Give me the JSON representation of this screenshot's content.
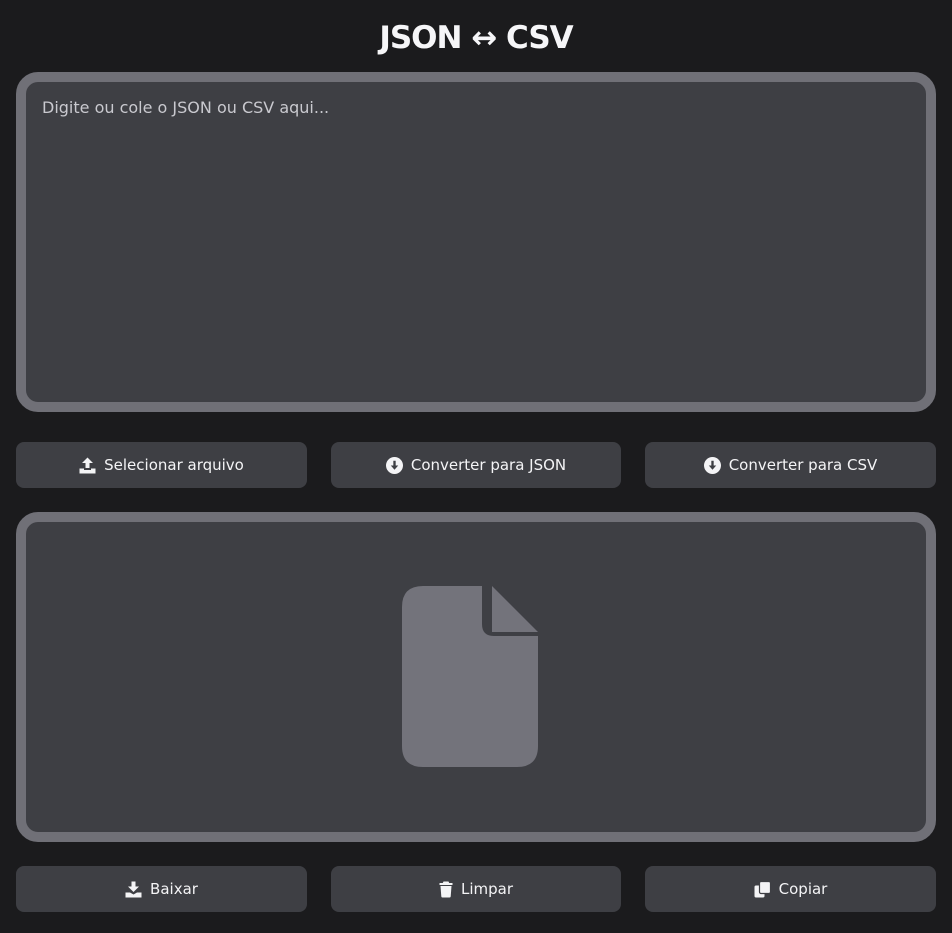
{
  "header": {
    "title": "JSON ↔ CSV"
  },
  "input": {
    "placeholder": "Digite ou cole o JSON ou CSV aqui..."
  },
  "actions": {
    "select_file": {
      "label": "Selecionar arquivo",
      "icon": "upload-icon"
    },
    "to_json": {
      "label": "Converter para JSON",
      "icon": "arrow-circle-down-icon"
    },
    "to_csv": {
      "label": "Converter para CSV",
      "icon": "arrow-circle-down-icon"
    }
  },
  "output": {
    "empty_icon": "file-icon"
  },
  "footer_actions": {
    "download": {
      "label": "Baixar",
      "icon": "download-icon"
    },
    "clear": {
      "label": "Limpar",
      "icon": "trash-icon"
    },
    "copy": {
      "label": "Copiar",
      "icon": "copy-icon"
    }
  },
  "colors": {
    "background": "#1b1b1d",
    "panel": "#3e3f44",
    "panel_border": "#707077",
    "text": "#f4f4f6",
    "placeholder_icon": "#73737b"
  }
}
